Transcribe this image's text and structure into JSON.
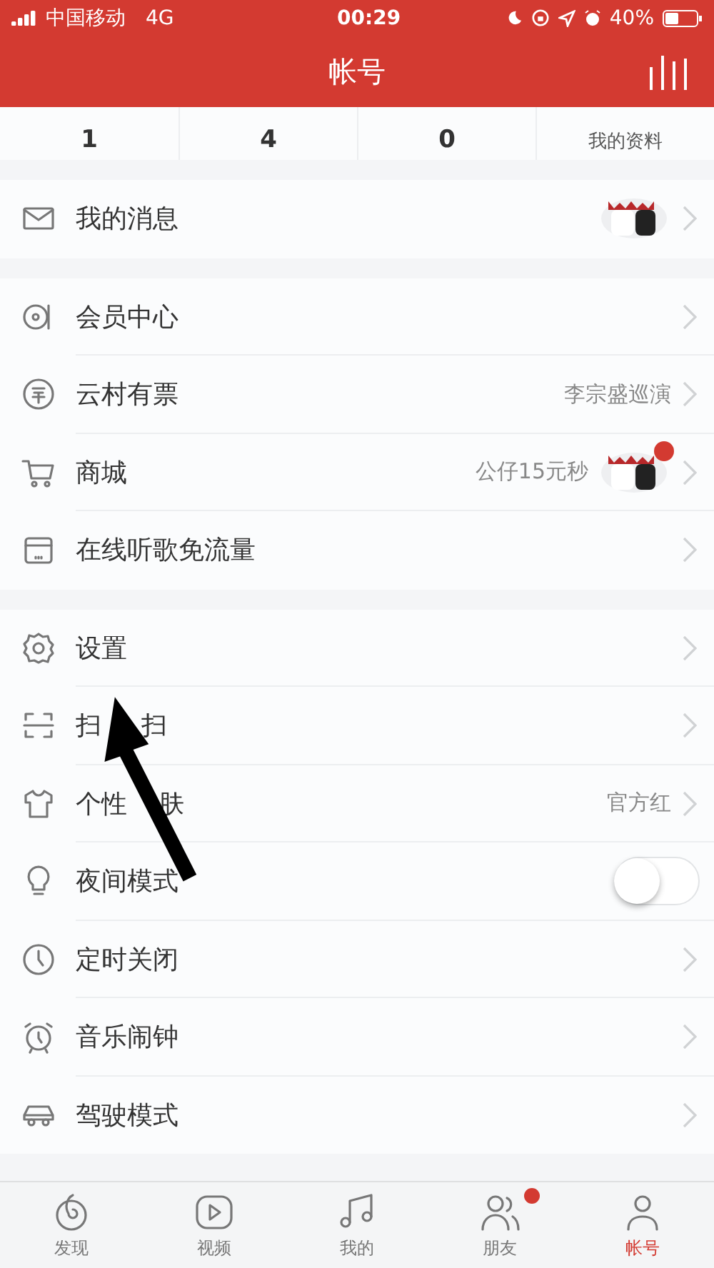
{
  "status_bar": {
    "carrier": "中国移动",
    "network": "4G",
    "time": "00:29",
    "battery": "40%"
  },
  "header": {
    "title": "帐号"
  },
  "stats": [
    {
      "kind": "count",
      "value": "1"
    },
    {
      "kind": "count",
      "value": "4"
    },
    {
      "kind": "count",
      "value": "0"
    },
    {
      "kind": "link",
      "label": "我的资料"
    }
  ],
  "sections": [
    {
      "items": [
        {
          "kind": "link",
          "label": "我的消息",
          "sticker": true
        }
      ]
    },
    {
      "items": [
        {
          "kind": "link",
          "label": "会员中心"
        },
        {
          "kind": "link",
          "label": "云村有票",
          "detail": "李宗盛巡演"
        },
        {
          "kind": "link",
          "label": "商城",
          "detail": "公仔15元秒",
          "sticker": true,
          "badge": true
        },
        {
          "kind": "link",
          "label": "在线听歌免流量"
        }
      ]
    },
    {
      "items": [
        {
          "kind": "link",
          "label": "设置"
        },
        {
          "kind": "link",
          "label_parts": [
            "扫",
            "扫"
          ]
        },
        {
          "kind": "link",
          "label_parts": [
            "个性",
            "肤"
          ],
          "detail": "官方红"
        },
        {
          "kind": "toggle",
          "label": "夜间模式",
          "on": false
        },
        {
          "kind": "link",
          "label": "定时关闭"
        },
        {
          "kind": "link",
          "label": "音乐闹钟"
        },
        {
          "kind": "link",
          "label": "驾驶模式"
        }
      ]
    }
  ],
  "tabs": [
    {
      "label": "发现",
      "selected": false,
      "badge": false
    },
    {
      "label": "视频",
      "selected": false,
      "badge": false
    },
    {
      "label": "我的",
      "selected": false,
      "badge": false
    },
    {
      "label": "朋友",
      "selected": false,
      "badge": true
    },
    {
      "label": "帐号",
      "selected": true,
      "badge": false
    }
  ]
}
